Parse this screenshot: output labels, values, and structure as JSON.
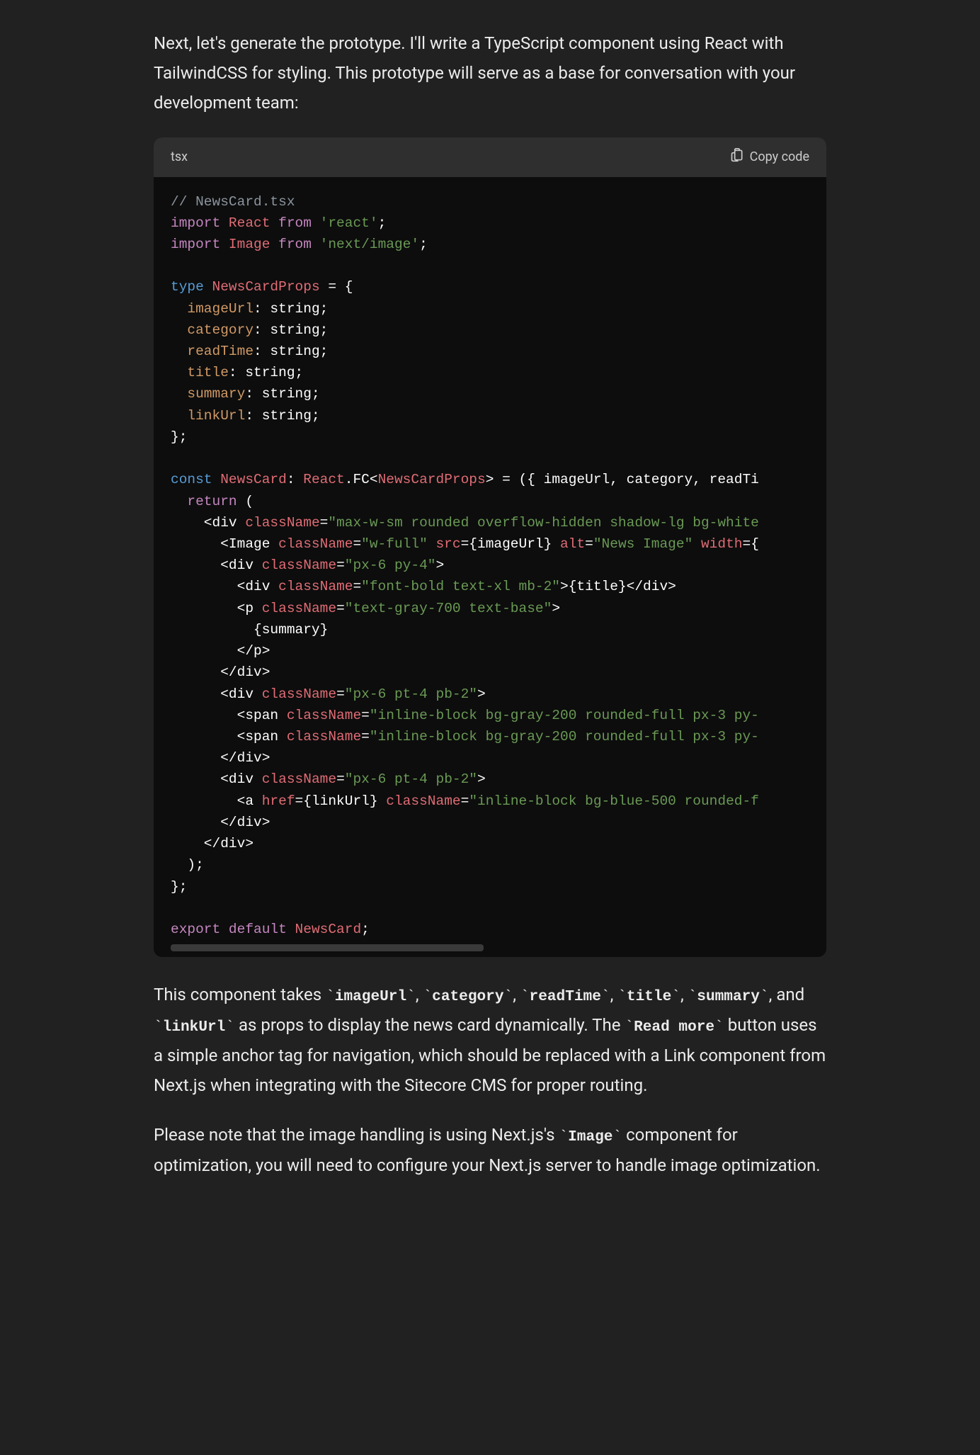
{
  "intro": "Next, let's generate the prototype. I'll write a TypeScript component using React with TailwindCSS for styling. This prototype will serve as a base for conversation with your development team:",
  "codeHeader": {
    "lang": "tsx",
    "copy": "Copy code"
  },
  "code": {
    "l1": "// NewsCard.tsx",
    "l2_import": "import",
    "l2_react": "React",
    "l2_from": "from",
    "l2_reactstr": "'react'",
    "l3_image": "Image",
    "l3_nextimg": "'next/image'",
    "l5_type": "type",
    "l5_name": "NewsCardProps",
    "l5_eq": " = {",
    "p_imageUrl": "imageUrl",
    "p_category": "category",
    "p_readTime": "readTime",
    "p_title": "title",
    "p_summary": "summary",
    "p_linkUrl": "linkUrl",
    "p_string": ": string;",
    "l12_close": "};",
    "l14_const": "const",
    "l14_name": "NewsCard",
    "l14_react": "React",
    "l14_fc": ".FC<",
    "l14_props": "NewsCardProps",
    "l14_rest": "> = ({ imageUrl, category, readTi",
    "l15_return": "return",
    "l15_paren": " (",
    "l16_a": "    <div ",
    "l16_cn": "className",
    "l16_eq": "=",
    "l16_v": "\"max-w-sm rounded overflow-hidden shadow-lg bg-white",
    "l17_a": "      <Image ",
    "l17_v1": "\"w-full\"",
    "l17_src": "src",
    "l17_srcv": "={imageUrl} ",
    "l17_alt": "alt",
    "l17_altv": "\"News Image\"",
    "l17_width": "width",
    "l17_widthv": "={",
    "l18_a": "      <div ",
    "l18_v": "\"px-6 py-4\"",
    "l19_a": "        <div ",
    "l19_v": "\"font-bold text-xl mb-2\"",
    "l19_t": ">{title}</div>",
    "l20_a": "        <p ",
    "l20_v": "\"text-gray-700 text-base\"",
    "l21": "          {summary}",
    "l22": "        </p>",
    "l23": "      </div>",
    "l24_a": "      <div ",
    "l24_v": "\"px-6 pt-4 pb-2\"",
    "l25_a": "        <span ",
    "l25_v": "\"inline-block bg-gray-200 rounded-full px-3 py-",
    "l27": "      </div>",
    "l28_a": "      <div ",
    "l28_v": "\"px-6 pt-4 pb-2\"",
    "l29_a": "        <a ",
    "l29_href": "href",
    "l29_hrefv": "={linkUrl} ",
    "l29_v": "\"inline-block bg-blue-500 rounded-f",
    "l30": "      </div>",
    "l31": "    </div>",
    "l32": "  );",
    "l33": "};",
    "l35_export": "export",
    "l35_default": "default",
    "l35_name": "NewsCard"
  },
  "para2": {
    "t1": "This component takes ",
    "c1": "imageUrl",
    "t2": ", ",
    "c2": "category",
    "t3": ", ",
    "c3": "readTime",
    "t4": ", ",
    "c4": "title",
    "t5": ", ",
    "c5": "summary",
    "t6": ", and ",
    "c6": "linkUrl",
    "t7": " as props to display the news card dynamically. The ",
    "c7": "Read more",
    "t8": " button uses a simple anchor tag for navigation, which should be replaced with a Link component from Next.js when integrating with the Sitecore CMS for proper routing."
  },
  "para3": {
    "t1": "Please note that the image handling is using Next.js's ",
    "c1": "Image",
    "t2": " component for optimization, you will need to configure your Next.js server to handle image optimization."
  }
}
